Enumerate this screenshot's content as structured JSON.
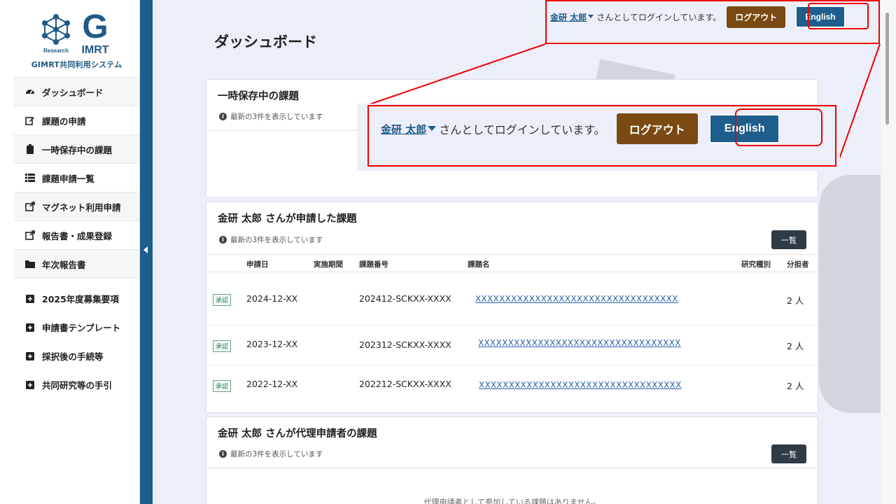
{
  "brand": {
    "system_name": "GIMRT共同利用システム",
    "logo_g": "G",
    "logo_imrt": "IMRT",
    "logo_research": "Research"
  },
  "nav": {
    "items": [
      {
        "label": "ダッシュボード",
        "icon": "dashboard-icon"
      },
      {
        "label": "課題の申請",
        "icon": "edit-icon"
      },
      {
        "label": "一時保存中の課題",
        "icon": "clipboard-icon"
      },
      {
        "label": "課題申請一覧",
        "icon": "list-icon"
      },
      {
        "label": "マグネット利用申請",
        "icon": "external-link-icon"
      },
      {
        "label": "報告書・成果登録",
        "icon": "external-link-icon"
      },
      {
        "label": "年次報告書",
        "icon": "folder-icon"
      }
    ],
    "links": [
      {
        "label": "2025年度募集要項",
        "icon": "plus-square-icon"
      },
      {
        "label": "申請書テンプレート",
        "icon": "plus-square-icon"
      },
      {
        "label": "採択後の手続等",
        "icon": "plus-square-icon"
      },
      {
        "label": "共同研究等の手引",
        "icon": "plus-square-icon"
      }
    ]
  },
  "header": {
    "user_name": "金研 太郎",
    "login_text": "さんとしてログインしています。",
    "logout_label": "ログアウト",
    "english_label": "English"
  },
  "page": {
    "title": "ダッシュボード"
  },
  "drafts": {
    "title": "一時保存中の課題",
    "note": "最新の3件を表示しています"
  },
  "applied": {
    "title": "金研 太郎 さんが申請した課題",
    "note": "最新の3件を表示しています",
    "list_button": "一覧",
    "columns": [
      "申請日",
      "実施期間",
      "課題番号",
      "課題名",
      "研究種別",
      "分担者"
    ],
    "rows": [
      {
        "status": "承認",
        "date": "2024-12-XX",
        "number": "202412-SCKXX-XXXX",
        "name": "XXXXXXXXXXXXXXXXXXXXXXXXXXXXXXXXXX",
        "members": "2 人"
      },
      {
        "status": "承認",
        "date": "2023-12-XX",
        "number": "202312-SCKXX-XXXX",
        "name": "XXXXXXXXXXXXXXXXXXXXXXXXXXXXXXXXXX",
        "members": "2 人"
      },
      {
        "status": "承認",
        "date": "2022-12-XX",
        "number": "202212-SCKXX-XXXX",
        "name": "XXXXXXXXXXXXXXXXXXXXXXXXXXXXXXXXXX",
        "members": "2 人"
      }
    ]
  },
  "proxy": {
    "title": "金研 太郎 さんが代理申請者の課題",
    "note": "最新の3件を表示しています",
    "list_button": "一覧",
    "empty": "代理申請者として参加している課題はありません。"
  },
  "colors": {
    "brand_blue": "#1d5e8c",
    "logout_brown": "#7a4a12",
    "highlight_red": "#e00000",
    "approved_green": "#2e7d55"
  }
}
